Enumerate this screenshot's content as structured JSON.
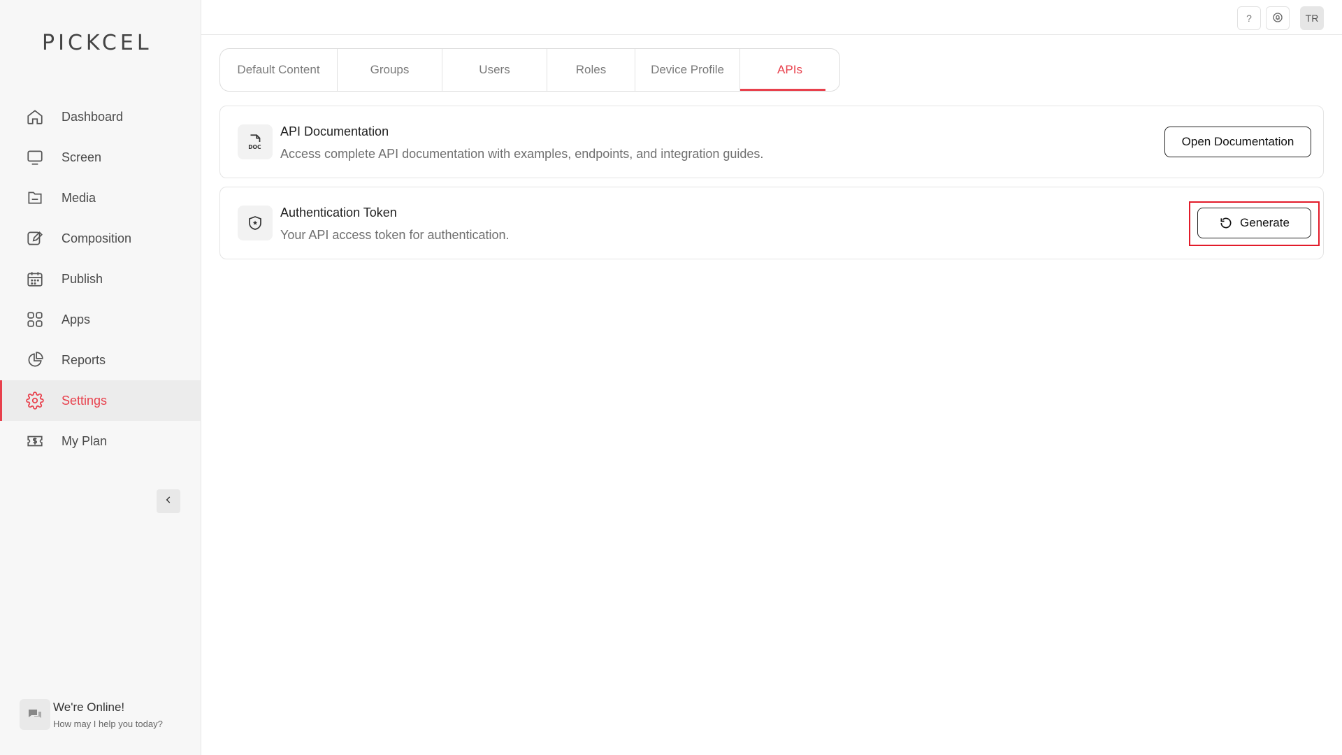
{
  "brand": {
    "logo_text": "PICKCEL",
    "accent": "#e8404c"
  },
  "sidebar": {
    "items": [
      {
        "label": "Dashboard",
        "icon": "home-icon",
        "active": false
      },
      {
        "label": "Screen",
        "icon": "monitor-icon",
        "active": false
      },
      {
        "label": "Media",
        "icon": "folder-icon",
        "active": false
      },
      {
        "label": "Composition",
        "icon": "edit-icon",
        "active": false
      },
      {
        "label": "Publish",
        "icon": "calendar-icon",
        "active": false
      },
      {
        "label": "Apps",
        "icon": "grid-icon",
        "active": false
      },
      {
        "label": "Reports",
        "icon": "pie-chart-icon",
        "active": false
      },
      {
        "label": "Settings",
        "icon": "gear-icon",
        "active": true
      },
      {
        "label": "My Plan",
        "icon": "dollar-ticket-icon",
        "active": false
      }
    ],
    "collapse_icon": "chevron-left-icon"
  },
  "chat": {
    "title": "We're Online!",
    "subtitle": "How may I help you today?"
  },
  "topbar": {
    "help_label": "?",
    "avatar_initials": "TR"
  },
  "tabs": [
    {
      "label": "Default Content",
      "active": false
    },
    {
      "label": "Groups",
      "active": false
    },
    {
      "label": "Users",
      "active": false
    },
    {
      "label": "Roles",
      "active": false
    },
    {
      "label": "Device Profile",
      "active": false
    },
    {
      "label": "APIs",
      "active": true
    }
  ],
  "cards": {
    "docs": {
      "icon": "doc-file-icon",
      "title": "API Documentation",
      "description": "Access complete API documentation with examples, endpoints, and integration guides.",
      "button_label": "Open Documentation"
    },
    "token": {
      "icon": "shield-star-icon",
      "title": "Authentication Token",
      "description": "Your API access token for authentication.",
      "button_label": "Generate",
      "button_icon": "refresh-icon",
      "highlight_color": "#e21b2a"
    }
  }
}
